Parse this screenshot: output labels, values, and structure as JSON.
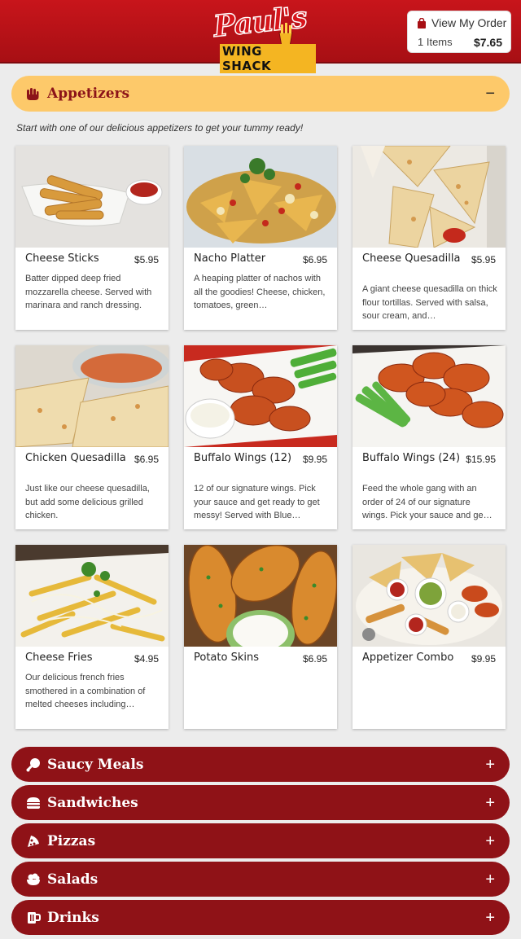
{
  "header": {
    "logo_script": "Paul's",
    "logo_sub": "WING SHACK",
    "order_label": "View My Order",
    "order_items": "1 Items",
    "order_total": "$7.65"
  },
  "appetizers": {
    "title": "Appetizers",
    "toggle": "−",
    "intro": "Start with one of our delicious appetizers to get your tummy ready!",
    "items": [
      {
        "name": "Cheese Sticks",
        "price": "$5.95",
        "desc": "Batter dipped deep fried mozzarella cheese. Served with marinara and ranch dressing."
      },
      {
        "name": "Nacho Platter",
        "price": "$6.95",
        "desc": "A heaping platter of nachos with all the goodies! Cheese, chicken, tomatoes, green…"
      },
      {
        "name": "Cheese Quesadilla",
        "price": "$5.95",
        "desc": "A giant cheese quesadilla on thick flour tortillas. Served with salsa, sour cream, and…"
      },
      {
        "name": "Chicken Quesadilla",
        "price": "$6.95",
        "desc": "Just like our cheese quesadilla, but add some delicious grilled chicken."
      },
      {
        "name": "Buffalo Wings (12)",
        "price": "$9.95",
        "desc": "12 of our signature wings. Pick your sauce and get ready to get messy! Served with Blue…"
      },
      {
        "name": "Buffalo Wings (24)",
        "price": "$15.95",
        "desc": "Feed the whole gang with an order of 24 of our signature wings. Pick your sauce and ge…"
      },
      {
        "name": "Cheese Fries",
        "price": "$4.95",
        "desc": "Our delicious french fries smothered in a combination of melted cheeses including…"
      },
      {
        "name": "Potato Skins",
        "price": "$6.95",
        "desc": ""
      },
      {
        "name": "Appetizer Combo",
        "price": "$9.95",
        "desc": ""
      }
    ]
  },
  "categories": [
    {
      "title": "Saucy Meals",
      "toggle": "+",
      "icon": "drumstick-icon"
    },
    {
      "title": "Sandwiches",
      "toggle": "+",
      "icon": "burger-icon"
    },
    {
      "title": "Pizzas",
      "toggle": "+",
      "icon": "pizza-icon"
    },
    {
      "title": "Salads",
      "toggle": "+",
      "icon": "salad-icon"
    },
    {
      "title": "Drinks",
      "toggle": "+",
      "icon": "mug-icon"
    }
  ],
  "colors": {
    "brand_red": "#a70f14",
    "accordion_red": "#8f1217",
    "accordion_gold": "#fdc96a"
  }
}
